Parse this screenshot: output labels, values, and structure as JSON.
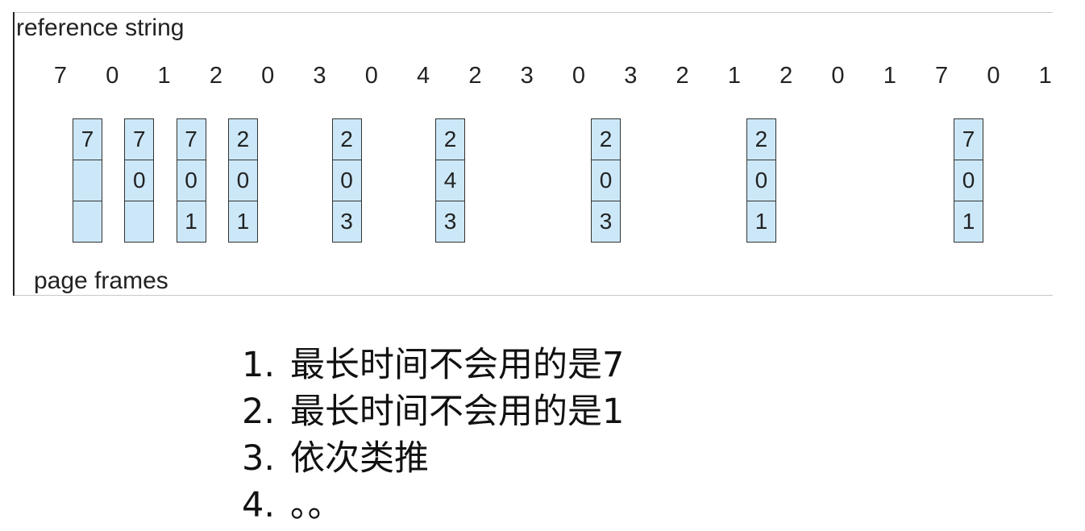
{
  "diagram": {
    "reference_label": "reference string",
    "frames_label": "page frames",
    "reference_string": [
      "7",
      "0",
      "1",
      "2",
      "0",
      "3",
      "0",
      "4",
      "2",
      "3",
      "0",
      "3",
      "2",
      "1",
      "2",
      "0",
      "1",
      "7",
      "0",
      "1"
    ],
    "frame_states": [
      {
        "ref_index": 0,
        "frames": [
          "7",
          "",
          ""
        ]
      },
      {
        "ref_index": 1,
        "frames": [
          "7",
          "0",
          ""
        ]
      },
      {
        "ref_index": 2,
        "frames": [
          "7",
          "0",
          "1"
        ]
      },
      {
        "ref_index": 3,
        "frames": [
          "2",
          "0",
          "1"
        ]
      },
      {
        "ref_index": 5,
        "frames": [
          "2",
          "0",
          "3"
        ]
      },
      {
        "ref_index": 7,
        "frames": [
          "2",
          "4",
          "3"
        ]
      },
      {
        "ref_index": 10,
        "frames": [
          "2",
          "0",
          "3"
        ]
      },
      {
        "ref_index": 13,
        "frames": [
          "2",
          "0",
          "1"
        ]
      },
      {
        "ref_index": 17,
        "frames": [
          "7",
          "0",
          "1"
        ]
      }
    ],
    "frame_color": "#cce8f8"
  },
  "notes": [
    {
      "num": "1.",
      "text": "最长时间不会用的是7"
    },
    {
      "num": "2.",
      "text": "最长时间不会用的是1"
    },
    {
      "num": "3.",
      "text": "依次类推"
    },
    {
      "num": "4.",
      "text": "。。"
    }
  ]
}
